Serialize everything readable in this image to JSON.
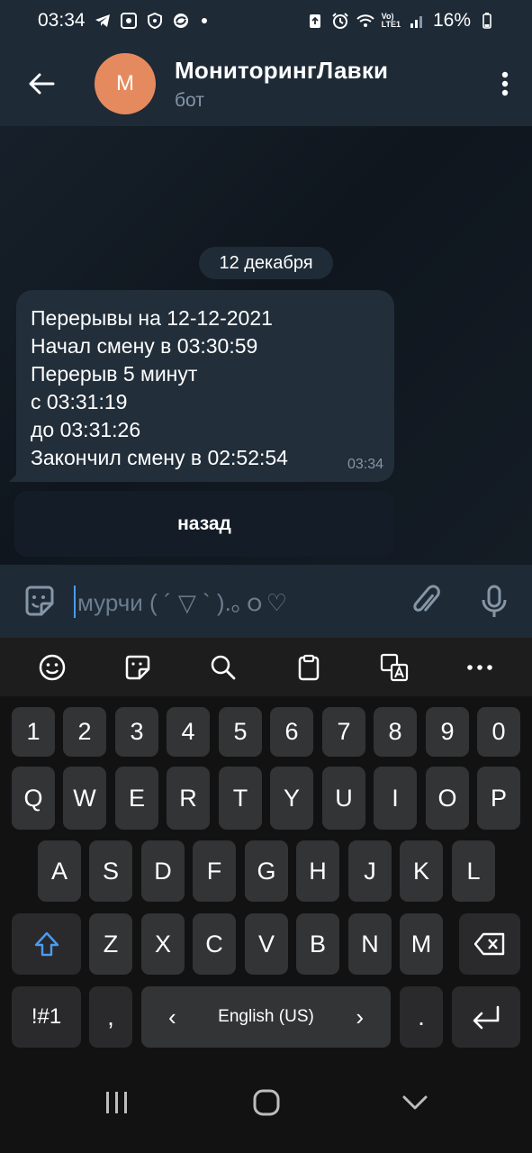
{
  "status_bar": {
    "time": "03:34",
    "battery": "16%",
    "network_badge_top": "Vo)",
    "network_badge_bottom": "LTE1"
  },
  "header": {
    "avatar_letter": "М",
    "title": "МониторингЛавки",
    "subtitle": "бот",
    "avatar_color": "#e58a5f"
  },
  "chat": {
    "date_separator": "12 декабря",
    "message": {
      "lines": [
        "Перерывы на 12-12-2021",
        "Начал смену в 03:30:59",
        "Перерыв 5 минут",
        "с 03:31:19",
        "до 03:31:26",
        "Закончил смену в 02:52:54"
      ],
      "time": "03:34"
    },
    "inline_button": "назад"
  },
  "input_bar": {
    "placeholder": "мурчи ( ´ ▽ ` ).｡ｏ♡"
  },
  "keyboard": {
    "toolbar_icons": [
      "emoji-icon",
      "sticker-icon",
      "search-icon",
      "clipboard-icon",
      "translate-icon",
      "more-icon"
    ],
    "row_numbers": [
      "1",
      "2",
      "3",
      "4",
      "5",
      "6",
      "7",
      "8",
      "9",
      "0"
    ],
    "row_1": [
      "Q",
      "W",
      "E",
      "R",
      "T",
      "Y",
      "U",
      "I",
      "O",
      "P"
    ],
    "row_2": [
      "A",
      "S",
      "D",
      "F",
      "G",
      "H",
      "J",
      "K",
      "L"
    ],
    "row_3": [
      "Z",
      "X",
      "C",
      "V",
      "B",
      "N",
      "M"
    ],
    "symbols_key": "!#1",
    "comma_key": ",",
    "space_key": "English (US)",
    "space_left_arrow": "‹",
    "space_right_arrow": "›",
    "period_key": "."
  },
  "colors": {
    "accent": "#4c9bf0",
    "header_bg": "#1e2a36",
    "bubble_bg": "#222e3a"
  }
}
